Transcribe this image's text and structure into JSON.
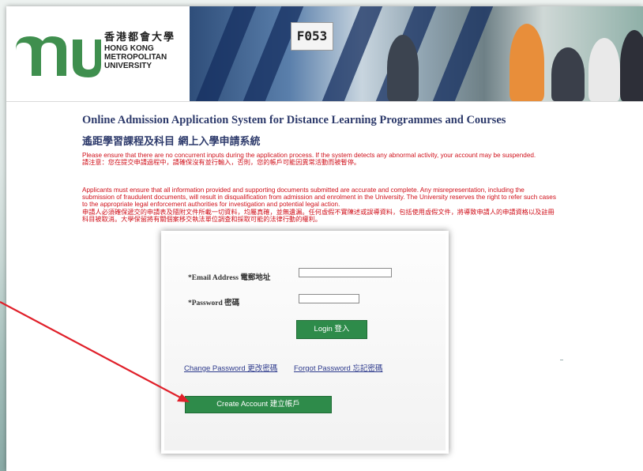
{
  "header": {
    "logo_cn": "香港都會大學",
    "logo_en_1": "HONG KONG",
    "logo_en_2": "METROPOLITAN",
    "logo_en_3": "UNIVERSITY",
    "photo_bib": "F053"
  },
  "page": {
    "title_en": "Online Admission Application System for Distance Learning Programmes and Courses",
    "title_cn": "遙距學習課程及科目 網上入學申請系統",
    "notice1_en": "Please ensure that there are no concurrent inputs during the application process. If the system detects any abnormal activity, your account may be suspended.",
    "notice1_cn": "請注意：您在提交申請過程中，請確保沒有並行輸入，否則，您的帳戶可能因異常活動而被暫停。",
    "notice2_en": "Applicants must ensure that all information provided and supporting documents submitted are accurate and complete. Any misrepresentation, including the submission of fraudulent documents, will result in disqualification from admission and enrolment in the University. The University reserves the right to refer such cases to the appropriate legal enforcement authorities for investigation and potential legal action.",
    "notice2_cn": "申請人必須確保遞交的申請表及隨附文件所載一切資料，均屬真確，並無遺漏。任何虛假不實陳述或誤導資料，包括使用虛假文件，將導致申請人的申請資格以及註冊科目被取消。大學保留將有關個案移交執法單位調查和採取可能的法律行動的權利。"
  },
  "login": {
    "email_label": "*Email Address 電郵地址",
    "email_value": "",
    "password_label": "*Password 密碼",
    "password_value": "",
    "login_button": "Login 登入",
    "change_password": "Change Password 更改密碼",
    "forgot_password": "Forgot Password 忘記密碼",
    "create_account": "Create Account 建立帳戶"
  },
  "colors": {
    "brand_green": "#2e8b4a",
    "notice_red": "#d0111b",
    "title_navy": "#2d3a6b",
    "annotation_arrow": "#e0202a"
  }
}
